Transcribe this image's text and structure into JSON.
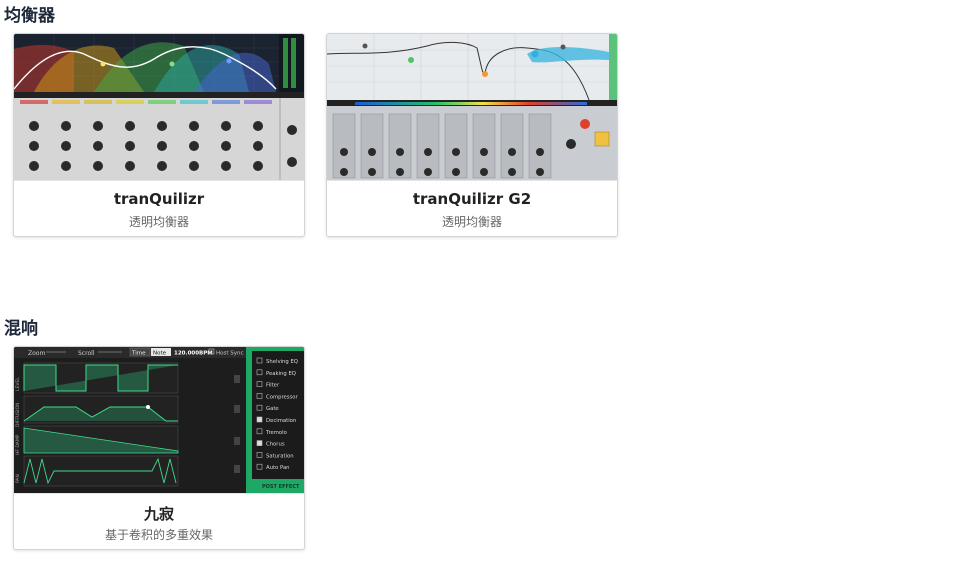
{
  "sections": [
    {
      "title": "均衡器",
      "cards": [
        {
          "title": "tranQuilizr",
          "subtitle": "透明均衡器"
        },
        {
          "title": "tranQuilizr G2",
          "subtitle": "透明均衡器"
        }
      ]
    },
    {
      "title": "混响",
      "cards": [
        {
          "title": "九寂",
          "subtitle": "基于卷积的多重效果"
        }
      ]
    }
  ],
  "thumb3": {
    "zoom": "Zoom",
    "scroll": "Scroll",
    "time": "Time",
    "note": "Note",
    "bpm": "120.000BPM",
    "host_sync": "Host Sync",
    "lanes": [
      "LEVEL",
      "DIFFUSION",
      "HF DAMP",
      "PAN"
    ],
    "effects": [
      "Shelving EQ",
      "Peaking EQ",
      "Filter",
      "Compressor",
      "Gate",
      "Decimation",
      "Tremolo",
      "Chorus",
      "Saturation",
      "Auto Pan"
    ],
    "effects_checked": [
      false,
      false,
      false,
      false,
      false,
      true,
      false,
      true,
      false,
      false
    ],
    "post_effect": "POST EFFECT"
  },
  "colors": {
    "eq_bg": "#1b2230",
    "g2_bg": "#e8ebee",
    "reverb_bg": "#1d1d1d",
    "reverb_accent": "#2bbf7a",
    "panel_green": "#1ea866"
  }
}
